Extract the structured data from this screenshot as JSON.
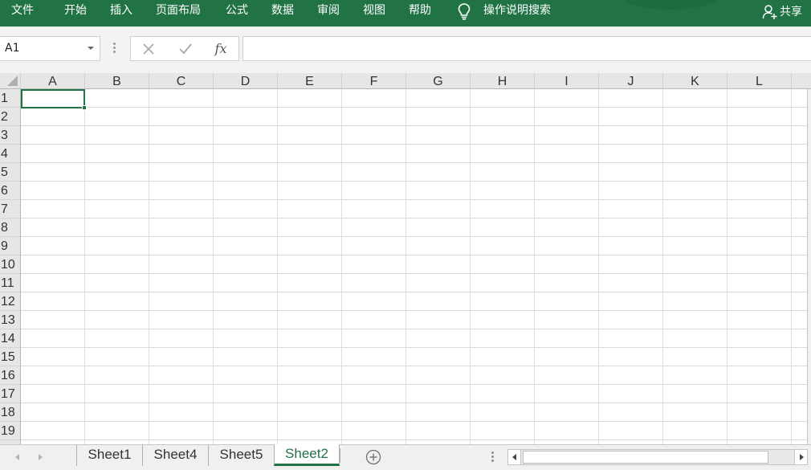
{
  "ribbon": {
    "tabs": [
      {
        "id": "file",
        "label": "文件"
      },
      {
        "id": "home",
        "label": "开始"
      },
      {
        "id": "insert",
        "label": "插入"
      },
      {
        "id": "page-layout",
        "label": "页面布局"
      },
      {
        "id": "formulas",
        "label": "公式"
      },
      {
        "id": "data",
        "label": "数据"
      },
      {
        "id": "review",
        "label": "审阅"
      },
      {
        "id": "view",
        "label": "视图"
      },
      {
        "id": "help",
        "label": "帮助"
      }
    ],
    "tell_me_icon": "lightbulb-icon",
    "tell_me_label": "操作说明搜索",
    "share_icon": "person-add-icon",
    "share_label": "共享"
  },
  "formula_bar": {
    "name_box_value": "A1",
    "cancel_icon": "close-icon",
    "enter_icon": "checkmark-icon",
    "function_label": "fx",
    "formula_value": ""
  },
  "grid": {
    "column_headers": [
      "A",
      "B",
      "C",
      "D",
      "E",
      "F",
      "G",
      "H",
      "I",
      "J",
      "K",
      "L"
    ],
    "row_headers": [
      "1",
      "2",
      "3",
      "4",
      "5",
      "6",
      "7",
      "8",
      "9",
      "10",
      "11",
      "12",
      "13",
      "14",
      "15",
      "16",
      "17",
      "18",
      "19"
    ],
    "active_cell": "A1"
  },
  "sheet_tabs": {
    "tabs": [
      "Sheet1",
      "Sheet4",
      "Sheet5",
      "Sheet2"
    ],
    "active": "Sheet2",
    "add_icon": "plus-circle-icon"
  },
  "colors": {
    "ribbon_green": "#217346",
    "gridline": "#dadada",
    "header_bg": "#e6e6e6"
  }
}
